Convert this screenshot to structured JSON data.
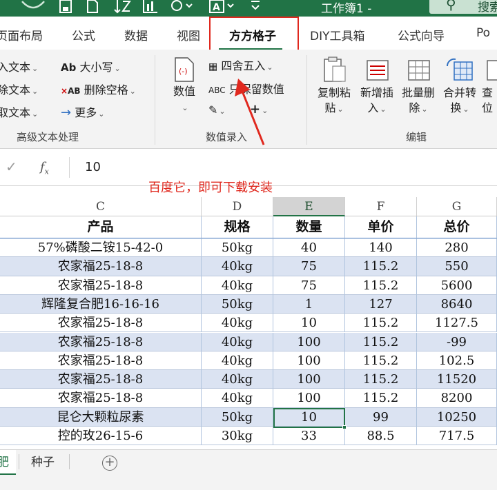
{
  "titlebar": {
    "doc_title": "工作簿1 -",
    "search_text": "搜索"
  },
  "tabs": [
    {
      "label": "页面布局"
    },
    {
      "label": "公式"
    },
    {
      "label": "数据"
    },
    {
      "label": "视图"
    },
    {
      "label": "方方格子",
      "active": true
    },
    {
      "label": "DIY工具箱"
    },
    {
      "label": "公式向导"
    },
    {
      "label": "Po"
    }
  ],
  "ribbon": {
    "text_group": {
      "items": [
        "入文本",
        "除文本",
        "取文本"
      ],
      "case_label": "大小写",
      "remove_space_label": "删除空格",
      "more_label": "更多",
      "group_label": "高级文本处理"
    },
    "number_group": {
      "numeric_label": "数值",
      "round_label": "四舍五入",
      "keep_numeric_label": "只保留数值",
      "group_label": "数值录入"
    },
    "edit_group": {
      "copy_paste_label_1": "复制粘",
      "copy_paste_label_2": "贴",
      "insert_label_1": "新增插",
      "insert_label_2": "入",
      "batch_delete_label_1": "批量删",
      "batch_delete_label_2": "除",
      "merge_label_1": "合并转",
      "merge_label_2": "换",
      "lookup_label_1": "查",
      "lookup_label_2": "位",
      "group_label": "编辑"
    }
  },
  "formula_bar": {
    "value": "10"
  },
  "annotation": {
    "text": "百度它，即可下载安装"
  },
  "columns": [
    "C",
    "D",
    "E",
    "F",
    "G"
  ],
  "table": {
    "headers": [
      "产品",
      "规格",
      "数量",
      "单价",
      "总价"
    ],
    "rows": [
      [
        "57%磷酸二铵15-42-0",
        "50kg",
        "40",
        "140",
        "280"
      ],
      [
        "农家福25-18-8",
        "40kg",
        "75",
        "115.2",
        "550"
      ],
      [
        "农家福25-18-8",
        "40kg",
        "75",
        "115.2",
        "5600"
      ],
      [
        "辉隆复合肥16-16-16",
        "50kg",
        "1",
        "127",
        "8640"
      ],
      [
        "农家福25-18-8",
        "40kg",
        "10",
        "115.2",
        "1127.5"
      ],
      [
        "农家福25-18-8",
        "40kg",
        "100",
        "115.2",
        "-99"
      ],
      [
        "农家福25-18-8",
        "40kg",
        "100",
        "115.2",
        "102.5"
      ],
      [
        "农家福25-18-8",
        "40kg",
        "100",
        "115.2",
        "11520"
      ],
      [
        "农家福25-18-8",
        "40kg",
        "100",
        "115.2",
        "8200"
      ],
      [
        "昆仑大颗粒尿素",
        "50kg",
        "10",
        "99",
        "10250"
      ],
      [
        "控的玫26-15-6",
        "30kg",
        "33",
        "88.5",
        "717.5"
      ]
    ]
  },
  "sheets": [
    {
      "label": "肥",
      "active": true
    },
    {
      "label": "种子"
    }
  ],
  "colors": {
    "excel_green": "#217346",
    "row_shade": "#dbe3f2",
    "annotation_red": "#e0281e"
  }
}
